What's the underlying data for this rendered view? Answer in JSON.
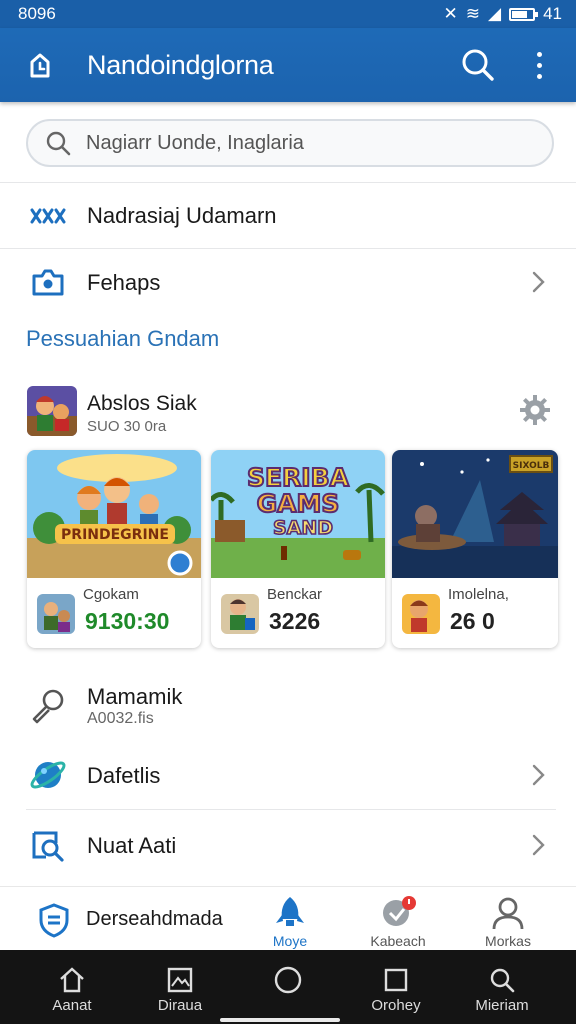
{
  "status_bar": {
    "time": "8096",
    "signal_text": "41",
    "battery_level": 0.75
  },
  "app_bar": {
    "title": "Nandoindglorna",
    "logo_icon": "clock-icon",
    "search_icon": "search-icon",
    "overflow_icon": "more-vertical-icon"
  },
  "search": {
    "placeholder": "Nagiarr Uonde, Inaglaria"
  },
  "menu": [
    {
      "label": "Nadrasiaj Udamarn",
      "icon": "shuffle-stars-icon"
    },
    {
      "label": "Fehaps",
      "icon": "camera-icon"
    }
  ],
  "section": {
    "title": "Pessuahian Gndam"
  },
  "featured": {
    "title": "Abslos Siak",
    "subtitle": "SUO 30 0ra"
  },
  "cards": [
    {
      "name": "Cgokam",
      "price": "9130:30",
      "price_color": "#1f8a2a",
      "art_text": "PRINDEGRINE"
    },
    {
      "name": "Benckar",
      "price": "3226",
      "price_color": "#222222",
      "art_text_1": "SERIBA",
      "art_text_2": "GAMS",
      "art_text_3": "SAND"
    },
    {
      "name": "Imolelna,",
      "price": "26  0",
      "price_color": "#222222",
      "art_text": "SIXOLB"
    }
  ],
  "list": [
    {
      "label": "Mamamik",
      "sub": "A0032.fis",
      "icon": "wrench-icon"
    },
    {
      "label": "Dafetlis",
      "icon": "planet-icon"
    },
    {
      "label": "Nuat Aati",
      "icon": "search-window-icon"
    }
  ],
  "bottom_tabs": [
    {
      "label": "Derseahdmada",
      "icon": "shield-icon"
    },
    {
      "label": "Moye",
      "icon": "rocket-icon",
      "active": true
    },
    {
      "label": "Kabeach",
      "icon": "notification-icon"
    },
    {
      "label": "Morkas",
      "icon": "person-icon"
    }
  ],
  "nav_bar": [
    {
      "label": "Aanat",
      "icon": "home-icon"
    },
    {
      "label": "Diraua",
      "icon": "gallery-icon"
    },
    {
      "label": "",
      "icon": "circle-home-icon"
    },
    {
      "label": "Orohey",
      "icon": "square-icon"
    },
    {
      "label": "Mieriam",
      "icon": "search-icon"
    }
  ],
  "colors": {
    "primary": "#1c63ae",
    "accent": "#2a72b6",
    "active_tab": "#1d74c7"
  }
}
